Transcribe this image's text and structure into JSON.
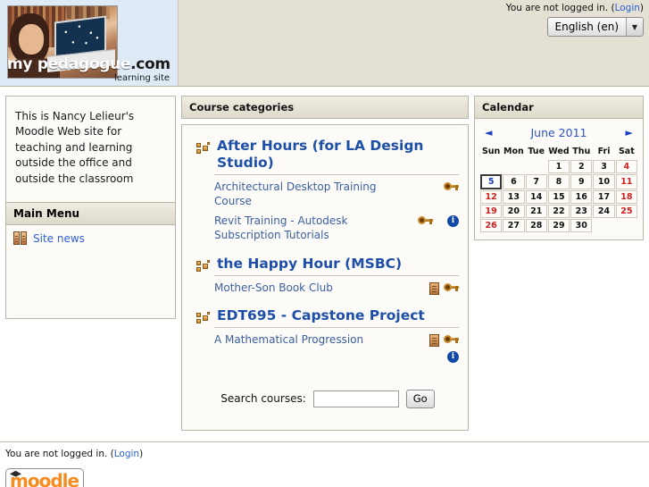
{
  "header": {
    "site_wordmark": "my pedagogue",
    "site_wordmark_suffix": ".com",
    "site_tagline": "learning site",
    "login_status": "You are not logged in. (",
    "login_link": "Login",
    "login_status_close": ")",
    "language_selected": "English (en)",
    "language_arrow": "▼"
  },
  "left_column": {
    "intro_text": "This is Nancy Lelieur's Moodle Web site for teaching and learning outside the office and outside the classroom",
    "main_menu_title": "Main Menu",
    "menu_items": [
      {
        "label": "Site news",
        "icon": "forum-icon"
      }
    ]
  },
  "center_column": {
    "block_title": "Course categories",
    "categories": [
      {
        "name": "After Hours (for LA Design Studio)",
        "courses": [
          {
            "name": "Architectural Desktop Training Course",
            "icons": [
              "key-icon"
            ]
          },
          {
            "name": "Revit Training - Autodesk Subscription Tutorials",
            "icons": [
              "key-icon",
              "info-icon"
            ]
          }
        ]
      },
      {
        "name": "the Happy Hour (MSBC)",
        "courses": [
          {
            "name": "Mother-Son Book Club",
            "icons": [
              "enrol-icon",
              "key-icon"
            ]
          }
        ]
      },
      {
        "name": "EDT695 - Capstone Project",
        "courses": [
          {
            "name": "A Mathematical Progression",
            "icons": [
              "enrol-icon",
              "key-icon",
              "info-icon"
            ]
          }
        ]
      }
    ],
    "search_label": "Search courses:",
    "search_value": "",
    "search_placeholder": "",
    "search_button": "Go"
  },
  "right_column": {
    "block_title": "Calendar",
    "prev_arrow": "◄",
    "month_label": "June 2011",
    "next_arrow": "►",
    "weekday_headers": [
      "Sun",
      "Mon",
      "Tue",
      "Wed",
      "Thu",
      "Fri",
      "Sat"
    ],
    "leading_blanks": 3,
    "days": [
      1,
      2,
      3,
      4,
      5,
      6,
      7,
      8,
      9,
      10,
      11,
      12,
      13,
      14,
      15,
      16,
      17,
      18,
      19,
      20,
      21,
      22,
      23,
      24,
      25,
      26,
      27,
      28,
      29,
      30
    ],
    "today": 5,
    "weekend_color": "#d02020",
    "today_color": "#1b3fc4"
  },
  "footer": {
    "login_status": "You are not logged in. (",
    "login_link": "Login",
    "login_status_close": ")",
    "logo_text": "moodle"
  }
}
